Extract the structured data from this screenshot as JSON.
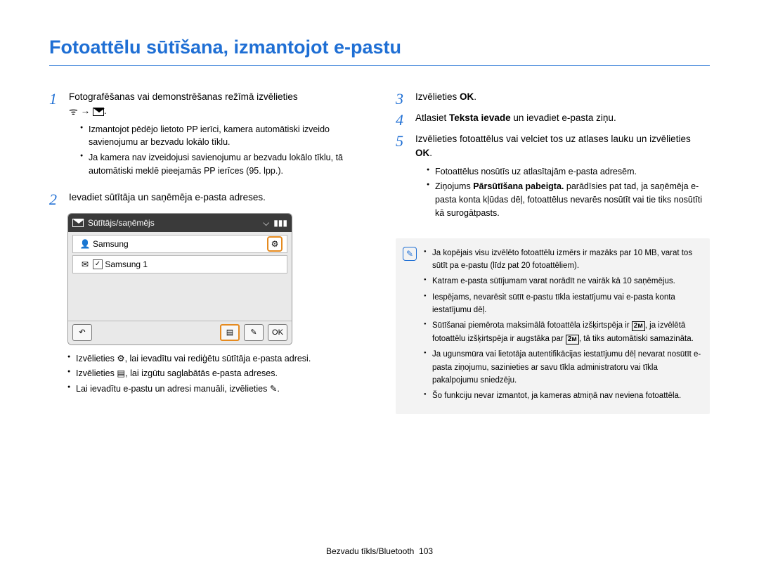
{
  "title": "Fotoattēlu sūtīšana, izmantojot e-pastu",
  "left": {
    "step1": {
      "num": "1",
      "text_a": "Fotografēšanas vai demonstrēšanas režīmā izvēlieties",
      "arrow": " → ",
      "bullets": [
        "Izmantojot pēdējo lietoto PP ierīci, kamera automātiski izveido savienojumu ar bezvadu lokālo tīklu.",
        "Ja kamera nav izveidojusi savienojumu ar bezvadu lokālo tīklu, tā automātiski meklē pieejamās PP ierīces (95. lpp.)."
      ]
    },
    "step2": {
      "num": "2",
      "text": "Ievadiet sūtītāja un saņēmēja e-pasta adreses.",
      "screenshot": {
        "header": "Sūtītājs/saņēmējs",
        "row1": "Samsung",
        "row2": "Samsung 1",
        "ok": "OK"
      },
      "bullets": [
        {
          "pre": "Izvēlieties ",
          "icon": "gear-icon",
          "post": ", lai ievadītu vai rediģētu sūtītāja e-pasta adresi."
        },
        {
          "pre": "Izvēlieties ",
          "icon": "contacts-icon",
          "post": ", lai izgūtu saglabātās e-pasta adreses."
        },
        {
          "pre": "Lai ievadītu e-pastu un adresi manuāli, izvēlieties ",
          "icon": "edit-icon",
          "post": "."
        }
      ]
    }
  },
  "right": {
    "step3": {
      "num": "3",
      "text_a": "Izvēlieties ",
      "bold": "OK",
      "text_b": "."
    },
    "step4": {
      "num": "4",
      "text_a": "Atlasiet ",
      "bold": "Teksta ievade",
      "text_b": " un ievadiet e-pasta ziņu."
    },
    "step5": {
      "num": "5",
      "text_a": "Izvēlieties fotoattēlus vai velciet tos uz atlases lauku un izvēlieties ",
      "bold": "OK",
      "text_b": ".",
      "bullets": [
        "Fotoattēlus nosūtīs uz atlasītajām e-pasta adresēm.",
        "Ziņojums Pārsūtīšana pabeigta. parādīsies pat tad, ja saņēmēja e-pasta konta kļūdas dēļ, fotoattēlus nevarēs nosūtīt vai tie tiks nosūtīti kā surogātpasts."
      ],
      "bullets_bold_idx": 1,
      "bullets_bold": "Pārsūtīšana pabeigta."
    },
    "note": [
      "Ja kopējais visu izvēlēto fotoattēlu izmērs ir mazāks par 10 MB, varat tos sūtīt pa e-pastu (līdz pat 20 fotoattēliem).",
      "Katram e-pasta sūtījumam varat norādīt ne vairāk kā 10 saņēmējus.",
      "Iespējams, nevarēsit sūtīt e-pastu tīkla iestatījumu vai e-pasta konta iestatījumu dēļ.",
      "Sūtīšanai piemērota maksimālā fotoattēla izšķirtspēja ir 2M, ja izvēlētā fotoattēlu izšķirtspēja ir augstāka par 2M, tā tiks automātiski samazināta.",
      "Ja ugunsmūra vai lietotāja autentifikācijas iestatījumu dēļ nevarat nosūtīt e-pasta ziņojumu, sazinieties ar savu tīkla administratoru vai tīkla pakalpojumu sniedzēju.",
      "Šo funkciju nevar izmantot, ja kameras atmiņā nav neviena fotoattēla."
    ]
  },
  "footer": {
    "section": "Bezvadu tīkls/Bluetooth",
    "page": "103"
  }
}
